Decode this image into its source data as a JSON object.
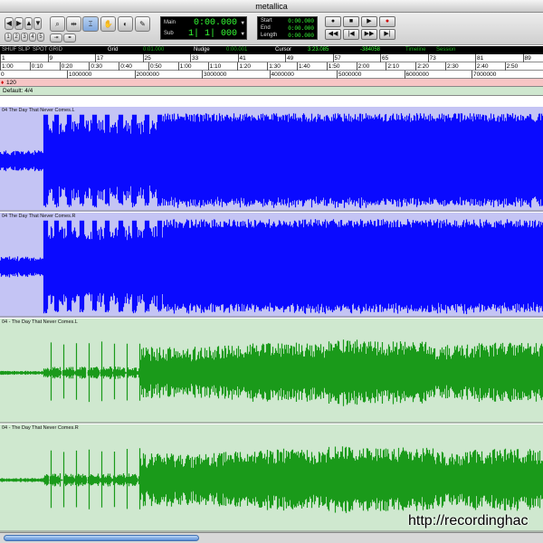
{
  "window": {
    "title": "metallica"
  },
  "counter": {
    "main_label": "Main",
    "sub_label": "Sub",
    "main_value": "0:00.000",
    "sub_value": "1| 1| 000"
  },
  "selection": {
    "start_label": "Start",
    "end_label": "End",
    "length_label": "Length",
    "start_value": "0:00.000",
    "end_value": "0:00.000",
    "length_value": "0:00.000"
  },
  "infobar": {
    "grid_label": "Grid",
    "grid_value": "0:01.000",
    "nudge_label": "Nudge",
    "nudge_value": "0:00.001",
    "cursor_label": "Cursor",
    "cursor_time": "3:23.085",
    "cursor_sample": "-384058",
    "timeline_label": "Timeline",
    "session_label": "Session"
  },
  "rulers": {
    "bars": [
      "1",
      "9",
      "17",
      "25",
      "33",
      "41",
      "49",
      "57",
      "65",
      "73",
      "81",
      "89"
    ],
    "minsecs": [
      "1:00",
      "0:10",
      "0:20",
      "0:30",
      "0:40",
      "0:50",
      "1:00",
      "1:10",
      "1:20",
      "1:30",
      "1:40",
      "1:50",
      "2:00",
      "2:10",
      "2:20",
      "2:30",
      "2:40",
      "2:50"
    ],
    "samples": [
      "0",
      "1000000",
      "2000000",
      "3000000",
      "4000000",
      "5000000",
      "6000000",
      "7000000"
    ],
    "tempo": "120",
    "meter": "Default: 4/4"
  },
  "tracks": [
    {
      "name": "04 The Day That Never Comes.L",
      "color": "#0a0aff",
      "bg": "#c4c4f4"
    },
    {
      "name": "04 The Day That Never Comes.R",
      "color": "#0a0aff",
      "bg": "#c4c4f4"
    },
    {
      "name": "04 - The Day That Never Comes.L",
      "color": "#1a9a1a",
      "bg": "#cfe8cf"
    },
    {
      "name": "04 - The Day That Never Comes.R",
      "color": "#1a9a1a",
      "bg": "#cfe8cf"
    }
  ],
  "watermark": "http://recordinghac"
}
